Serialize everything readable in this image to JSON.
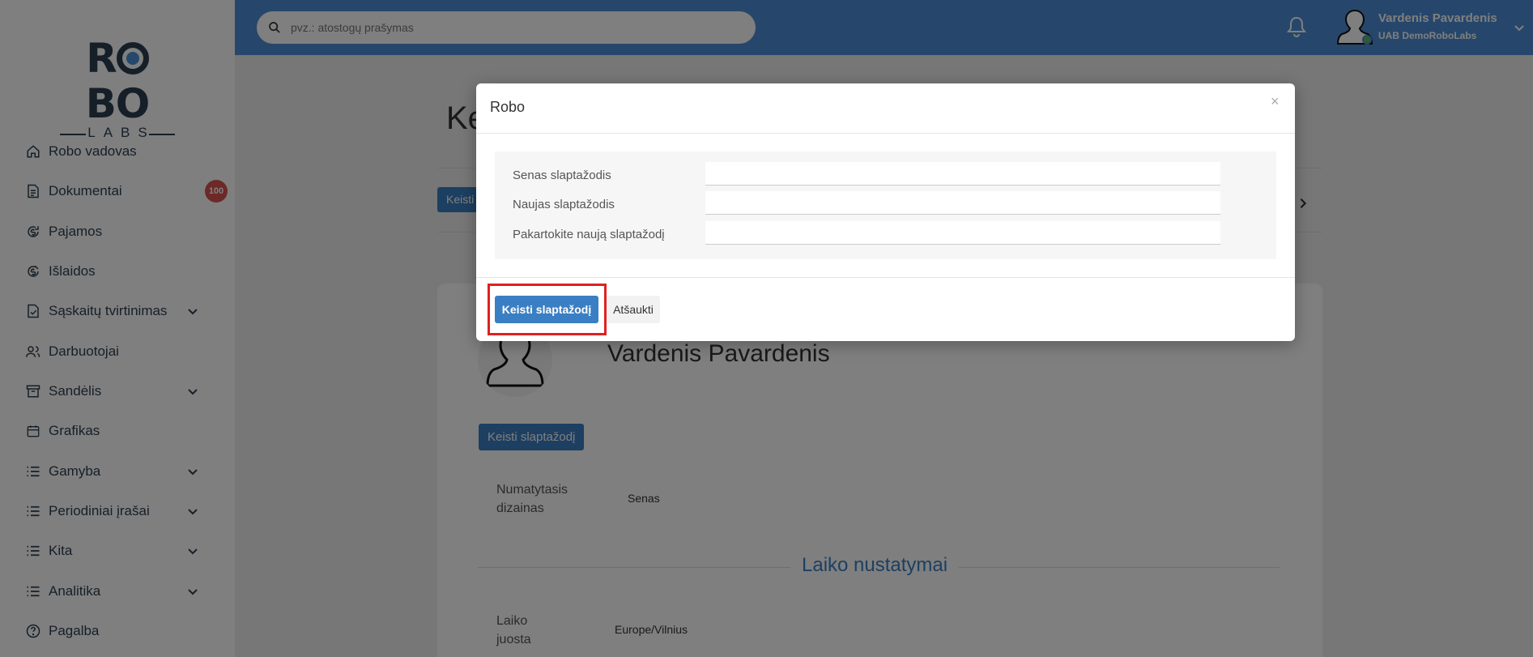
{
  "logo": {
    "top": "ROBO",
    "bottom": "LABS"
  },
  "sidebar": {
    "items": [
      {
        "label": "Robo vadovas",
        "icon": "home-icon"
      },
      {
        "label": "Dokumentai",
        "icon": "document-icon",
        "badge": "100"
      },
      {
        "label": "Pajamos",
        "icon": "income-icon"
      },
      {
        "label": "Išlaidos",
        "icon": "expenses-icon"
      },
      {
        "label": "Sąskaitų tvirtinimas",
        "icon": "invoice-check-icon",
        "expandable": true
      },
      {
        "label": "Darbuotojai",
        "icon": "users-icon"
      },
      {
        "label": "Sandėlis",
        "icon": "archive-icon",
        "expandable": true
      },
      {
        "label": "Grafikas",
        "icon": "calendar-icon"
      },
      {
        "label": "Gamyba",
        "icon": "list-icon",
        "expandable": true
      },
      {
        "label": "Periodiniai įrašai",
        "icon": "list-icon",
        "expandable": true
      },
      {
        "label": "Kita",
        "icon": "list-icon",
        "expandable": true
      },
      {
        "label": "Analitika",
        "icon": "list-icon",
        "expandable": true
      },
      {
        "label": "Pagalba",
        "icon": "help-icon"
      }
    ]
  },
  "header": {
    "search_placeholder": "pvz.: atostogų prašymas",
    "user_name": "Vardenis Pavardenis",
    "user_company": "UAB DemoRoboLabs"
  },
  "page": {
    "heading": "Ke",
    "small_button": "Keisti",
    "profile_name": "Vardenis Pavardenis",
    "change_password_button": "Keisti slaptažodį",
    "design_label": "Numatytasis dizainas",
    "design_value": "Senas",
    "time_section_title": "Laiko nustatymai",
    "timezone_label": "Laiko juosta",
    "timezone_value": "Europe/Vilnius"
  },
  "modal": {
    "title": "Robo",
    "close": "×",
    "fields": [
      {
        "label": "Senas slaptažodis",
        "value": ""
      },
      {
        "label": "Naujas slaptažodis",
        "value": ""
      },
      {
        "label": "Pakartokite naują slaptažodį",
        "value": ""
      }
    ],
    "submit_label": "Keisti slaptažodį",
    "cancel_label": "Atšaukti"
  },
  "colors": {
    "header": "#4c8fd6",
    "primary_button": "#3a7fc3",
    "badge": "#d9534f",
    "highlight": "#e02020",
    "online": "#5cb85c"
  }
}
